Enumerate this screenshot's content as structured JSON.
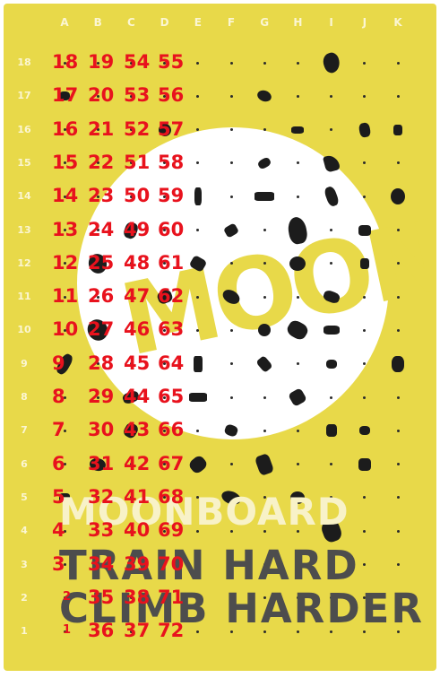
{
  "board": {
    "columns": [
      "A",
      "B",
      "C",
      "D",
      "E",
      "F",
      "G",
      "H",
      "I",
      "J",
      "K"
    ],
    "rows": [
      "18",
      "17",
      "16",
      "15",
      "14",
      "13",
      "12",
      "11",
      "10",
      "9",
      "8",
      "7",
      "6",
      "5",
      "4",
      "3",
      "2",
      "1"
    ],
    "logo_text": "MOON",
    "brand_text": "MOONBOARD",
    "slogan_line1": "TRAIN HARD",
    "slogan_line2": "CLIMB HARDER",
    "colors": {
      "board": "#e8d949",
      "circle": "#ffffff",
      "holds": "#1c1c1c",
      "annotation": "#e8121d"
    }
  },
  "annotations": {
    "col_a": [
      "18",
      "17",
      "16",
      "15",
      "14",
      "13",
      "12",
      "11",
      "10",
      "9",
      "8",
      "7",
      "6",
      "5",
      "4",
      "3",
      "2",
      "1"
    ],
    "col_b": [
      "19",
      "20",
      "21",
      "22",
      "23",
      "24",
      "25",
      "26",
      "27",
      "28",
      "29",
      "30",
      "31",
      "32",
      "33",
      "34",
      "35",
      "36"
    ],
    "col_c": [
      "54",
      "53",
      "52",
      "51",
      "50",
      "49",
      "48",
      "47",
      "46",
      "45",
      "44",
      "43",
      "42",
      "41",
      "40",
      "39",
      "38",
      "37"
    ],
    "col_d": [
      "55",
      "56",
      "57",
      "58",
      "59",
      "60",
      "61",
      "62",
      "63",
      "64",
      "65",
      "66",
      "67",
      "68",
      "69",
      "70",
      "71",
      "72"
    ]
  }
}
